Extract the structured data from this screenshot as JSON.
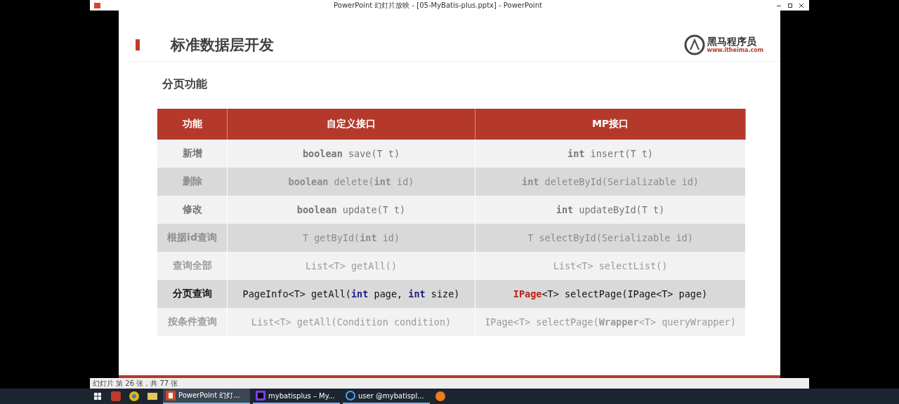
{
  "window": {
    "title": "PowerPoint 幻灯片放映 - [05-MyBatis-plus.pptx] - PowerPoint"
  },
  "slide": {
    "title": "标准数据层开发",
    "logo": {
      "name": "黑马程序员",
      "url": "www.itheima.com"
    },
    "subtitle": "分页功能",
    "table": {
      "columns": [
        "功能",
        "自定义接口",
        "MP接口"
      ],
      "rows": [
        {
          "kind": "normal",
          "selected": false,
          "feature": "新增",
          "custom": [
            {
              "text": "boolean",
              "kind": "keyword"
            },
            {
              "text": " save(T t)",
              "kind": "plain"
            }
          ],
          "mp": [
            {
              "text": "int",
              "kind": "keyword"
            },
            {
              "text": " insert(T t)",
              "kind": "plain"
            }
          ]
        },
        {
          "kind": "faded",
          "selected": false,
          "feature": "删除",
          "custom": [
            {
              "text": "boolean",
              "kind": "keyword"
            },
            {
              "text": " delete(",
              "kind": "plain"
            },
            {
              "text": "int",
              "kind": "keyword"
            },
            {
              "text": " id)",
              "kind": "plain"
            }
          ],
          "mp": [
            {
              "text": "int",
              "kind": "keyword"
            },
            {
              "text": " deleteById(Serializable id)",
              "kind": "plain"
            }
          ]
        },
        {
          "kind": "normal",
          "selected": false,
          "feature": "修改",
          "custom": [
            {
              "text": "boolean",
              "kind": "keyword"
            },
            {
              "text": " update(T t)",
              "kind": "plain"
            }
          ],
          "mp": [
            {
              "text": "int",
              "kind": "keyword"
            },
            {
              "text": " updateById(T t)",
              "kind": "plain"
            }
          ]
        },
        {
          "kind": "faded",
          "selected": false,
          "feature": "根据id查询",
          "custom": [
            {
              "text": "T getById(",
              "kind": "plain"
            },
            {
              "text": "int",
              "kind": "keyword"
            },
            {
              "text": " id)",
              "kind": "plain"
            }
          ],
          "mp": [
            {
              "text": "T selectById(Serializable id)",
              "kind": "plain"
            }
          ]
        },
        {
          "kind": "faded",
          "selected": false,
          "feature": "查询全部",
          "custom": [
            {
              "text": "List<T> getAll()",
              "kind": "plain"
            }
          ],
          "mp": [
            {
              "text": "List<T> selectList()",
              "kind": "plain"
            }
          ]
        },
        {
          "kind": "normal",
          "selected": true,
          "feature": "分页查询",
          "custom": [
            {
              "text": "PageInfo<T> getAll(",
              "kind": "plain"
            },
            {
              "text": "int",
              "kind": "keyword"
            },
            {
              "text": " page, ",
              "kind": "plain"
            },
            {
              "text": "int",
              "kind": "keyword"
            },
            {
              "text": " size)",
              "kind": "plain"
            }
          ],
          "mp": [
            {
              "text": "IPage",
              "kind": "type"
            },
            {
              "text": "<T> selectPage(IPage<T> page)",
              "kind": "plain"
            }
          ]
        },
        {
          "kind": "faded",
          "selected": false,
          "feature": "按条件查询",
          "custom": [
            {
              "text": "List<T> getAll(Condition condition)",
              "kind": "plain"
            }
          ],
          "mp": [
            {
              "text": "IPage<T> selectPage(",
              "kind": "plain"
            },
            {
              "text": "Wrapper",
              "kind": "keyword"
            },
            {
              "text": "<T> queryWrapper)",
              "kind": "plain"
            }
          ]
        }
      ]
    }
  },
  "status_bar": {
    "slide_info": "幻灯片 第 26 张，共 77 张"
  },
  "taskbar": {
    "items": [
      {
        "kind": "powerpoint",
        "label": "PowerPoint 幻灯...",
        "selected": true
      },
      {
        "kind": "idea",
        "label": "mybatisplus – My...",
        "selected": false
      },
      {
        "kind": "db",
        "label": "user @mybatispl...",
        "selected": false
      }
    ]
  }
}
